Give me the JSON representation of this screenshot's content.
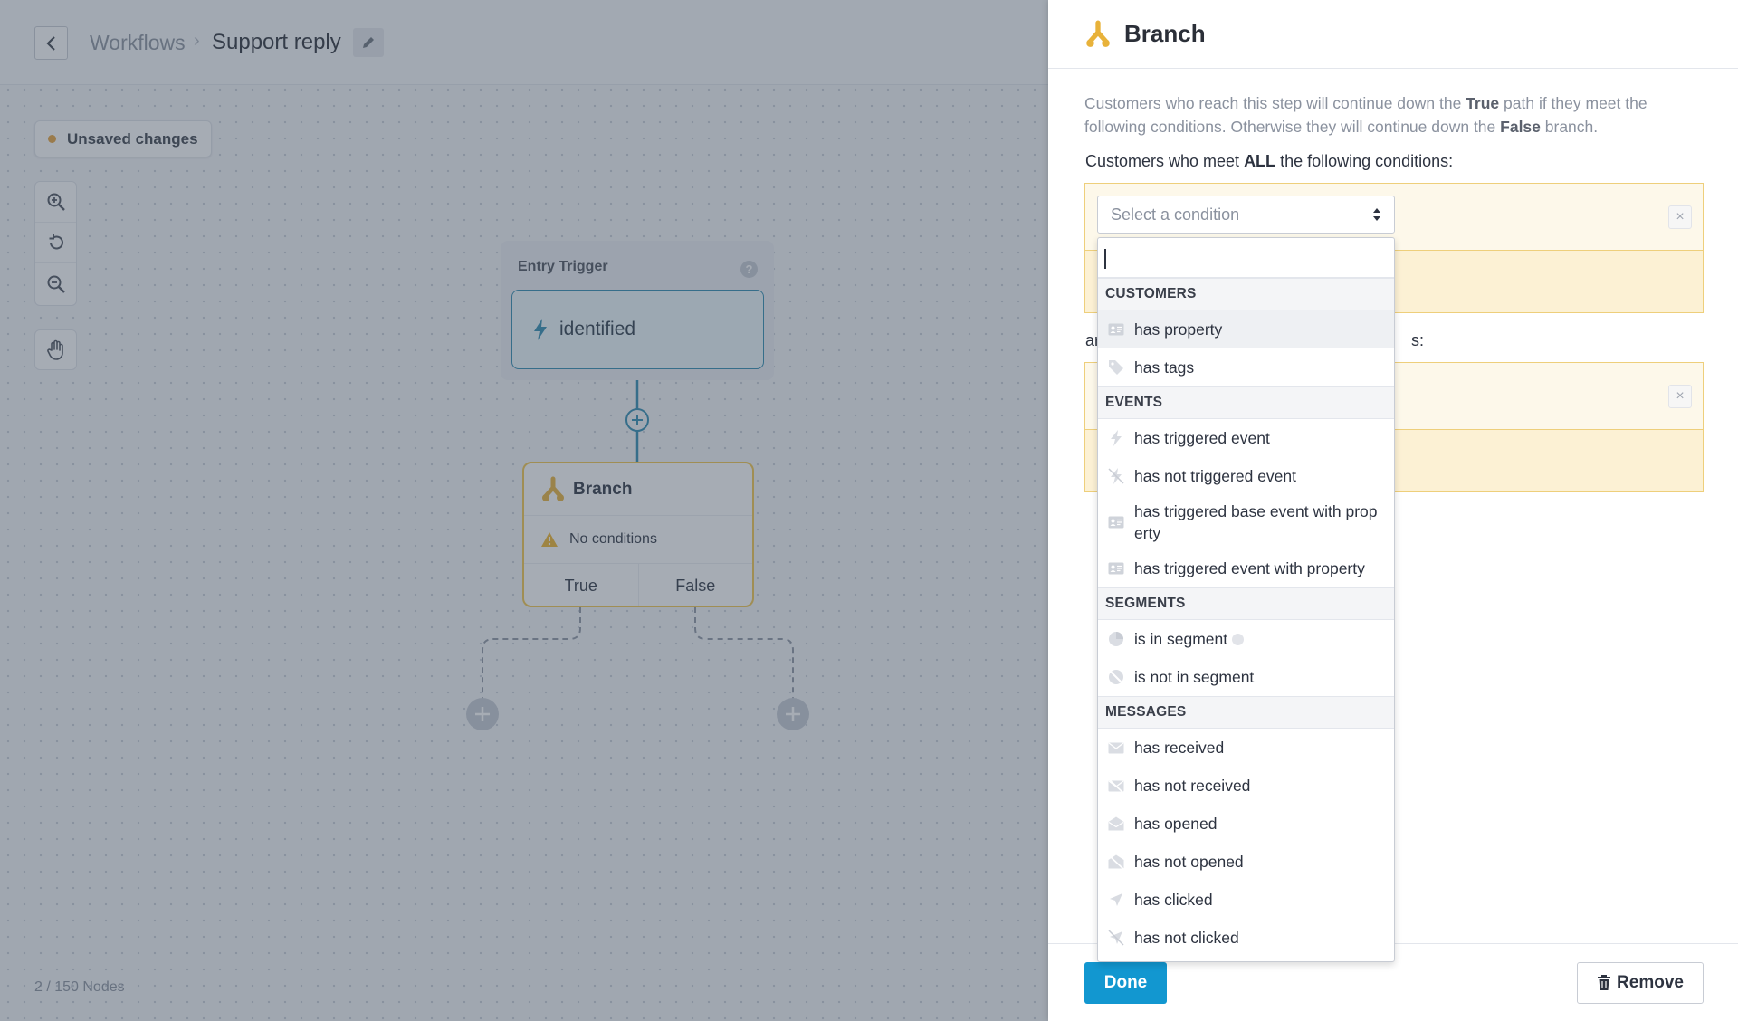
{
  "header": {
    "breadcrumb_root": "Workflows",
    "breadcrumb_separator": "›",
    "title": "Support reply"
  },
  "canvas": {
    "unsaved_label": "Unsaved changes",
    "entry_trigger": {
      "label": "Entry Trigger",
      "help": "?",
      "event": "identified"
    },
    "branch_node": {
      "title": "Branch",
      "warning": "No conditions",
      "true_label": "True",
      "false_label": "False"
    },
    "node_count": "2 / 150 Nodes"
  },
  "panel": {
    "title": "Branch",
    "description": {
      "p1": "Customers who reach this step will continue down the ",
      "b1": "True",
      "p2": " path if they meet the following conditions. Otherwise they will continue down the ",
      "b2": "False",
      "p3": " branch."
    },
    "all_prefix": "Customers who meet ",
    "all_bold": "ALL",
    "all_suffix": " the following conditions:",
    "any_prefix": "ar",
    "any_suffix": "s:",
    "select_placeholder": "Select a condition",
    "remove_x": "×",
    "dropdown": {
      "groups": [
        {
          "label": "CUSTOMERS",
          "items": [
            {
              "label": "has property",
              "icon": "id-card-icon"
            },
            {
              "label": "has tags",
              "icon": "tag-icon"
            }
          ]
        },
        {
          "label": "EVENTS",
          "items": [
            {
              "label": "has triggered event",
              "icon": "bolt-icon"
            },
            {
              "label": "has not triggered event",
              "icon": "bolt-slash-icon"
            },
            {
              "label": "has triggered base event with prop erty",
              "icon": "id-card-icon"
            },
            {
              "label": "has triggered event with property",
              "icon": "id-card-icon"
            }
          ]
        },
        {
          "label": "SEGMENTS",
          "items": [
            {
              "label": "is in segment",
              "icon": "pie-chart-icon"
            },
            {
              "label": "is not in segment",
              "icon": "pie-chart-slash-icon"
            }
          ]
        },
        {
          "label": "MESSAGES",
          "items": [
            {
              "label": "has received",
              "icon": "envelope-icon"
            },
            {
              "label": "has not received",
              "icon": "envelope-slash-icon"
            },
            {
              "label": "has opened",
              "icon": "envelope-open-icon"
            },
            {
              "label": "has not opened",
              "icon": "envelope-open-slash-icon"
            },
            {
              "label": "has clicked",
              "icon": "cursor-icon"
            },
            {
              "label": "has not clicked",
              "icon": "cursor-slash-icon"
            }
          ]
        }
      ]
    },
    "done_label": "Done",
    "remove_label": "Remove"
  },
  "colors": {
    "accent": "#1297d0",
    "branch_gold": "#e8b23a",
    "warning": "#f0b429",
    "condition_border": "#eecf7b",
    "overlay": "rgba(66,78,96,0.47)"
  }
}
